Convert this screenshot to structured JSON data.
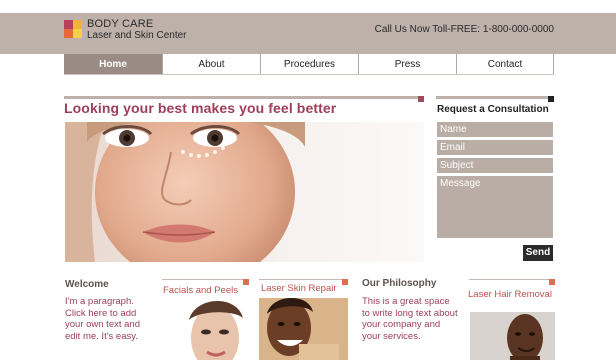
{
  "header": {
    "brand_line1": "BODY CARE",
    "brand_line2": "Laser and Skin Center",
    "phone": "Call Us Now Toll-FREE: 1-800-000-0000"
  },
  "nav": {
    "items": [
      {
        "label": "Home",
        "active": true
      },
      {
        "label": "About"
      },
      {
        "label": "Procedures"
      },
      {
        "label": "Press"
      },
      {
        "label": "Contact"
      }
    ]
  },
  "hero": {
    "title": "Looking your best makes you feel better"
  },
  "consultation": {
    "title": "Request a Consultation",
    "fields": [
      "Name",
      "Email",
      "Subject",
      "Message"
    ],
    "send_label": "Send"
  },
  "welcome": {
    "title": "Welcome",
    "text": "I'm a paragraph. Click here to add your own text and edit me. It's easy."
  },
  "philosophy": {
    "title": "Our Philosophy",
    "text": "This is a great space to write long text about your company and your services."
  },
  "services": [
    {
      "title": "Facials and Peels"
    },
    {
      "title": "Laser Skin Repair"
    },
    {
      "title": "Laser Hair Removal"
    }
  ],
  "colors": {
    "accent": "#9d3f59",
    "header_bg": "#bdb1aa",
    "nav_active": "#9a8c84",
    "service_title": "#c0504d"
  }
}
